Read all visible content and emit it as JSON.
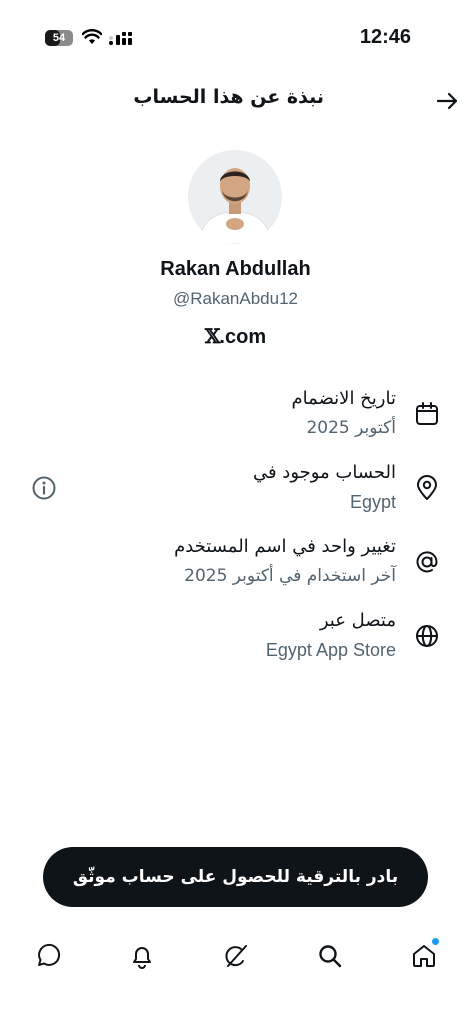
{
  "status_bar": {
    "time": "12:46",
    "battery_level": "54",
    "battery_fraction": 0.54,
    "icons": [
      "battery-icon",
      "wifi-icon",
      "signal-icon"
    ]
  },
  "header": {
    "title": "نبذة عن هذا الحساب",
    "back_icon": "arrow-right-icon"
  },
  "profile": {
    "display_name": "Rakan Abdullah",
    "handle": "@RakanAbdu12",
    "domain_suffix": ".com",
    "domain_logo": "𝕏"
  },
  "info": [
    {
      "icon": "calendar-icon",
      "title": "تاريخ الانضمام",
      "value": "أكتوبر 2025"
    },
    {
      "icon": "location-pin-icon",
      "title": "الحساب موجود في",
      "value": "Egypt"
    },
    {
      "icon": "at-sign-icon",
      "title": "تغيير واحد في اسم المستخدم",
      "value": "آخر استخدام في أكتوبر 2025"
    },
    {
      "icon": "globe-icon",
      "title": "متصل عبر",
      "value": "Egypt App Store"
    }
  ],
  "upgrade": {
    "label": "بادر بالترقية للحصول على حساب موثّق"
  },
  "bottom_nav": [
    {
      "icon": "messages-icon"
    },
    {
      "icon": "notifications-bell-icon"
    },
    {
      "icon": "grok-icon"
    },
    {
      "icon": "search-icon"
    },
    {
      "icon": "home-icon",
      "has_badge": true
    }
  ],
  "colors": {
    "text_primary": "#0f1419",
    "text_secondary": "#536471",
    "button_bg": "#0f1419",
    "badge": "#1d9bf0"
  }
}
